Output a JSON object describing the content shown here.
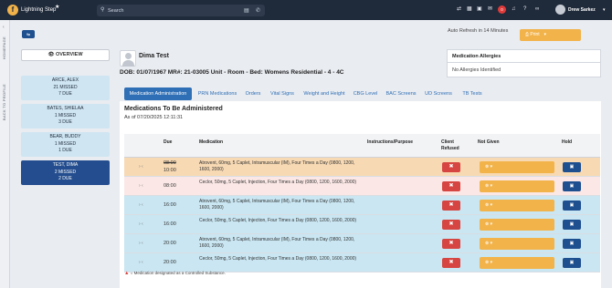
{
  "app": {
    "name": "Lightning Step",
    "logo_letter": "f",
    "search_placeholder": "Search"
  },
  "header": {
    "notification_count": "0",
    "user_name": "Drew Sarkez",
    "caret": "▾"
  },
  "rail": {
    "homepage_label": "HOMEPAGE",
    "back_label": "BACK TO PROFILE"
  },
  "sidebar": {
    "back_button": "⇆",
    "overview_label": "OVERVIEW",
    "patients": [
      {
        "name": "ARCE, ALEX",
        "missed": "21 MISSED",
        "due": "7 DUE"
      },
      {
        "name": "BATES, SHIELAA",
        "missed": "1 MISSED",
        "due": "3 DUE"
      },
      {
        "name": "BEAR, BUDDY",
        "missed": "1 MISSED",
        "due": "1 DUE"
      },
      {
        "name": "TEST, DIMA",
        "missed": "2 MISSED",
        "due": "2 DUE"
      }
    ]
  },
  "main": {
    "auto_refresh": "Auto Refresh in 14 Minutes",
    "print_label": "Print",
    "patient_name": "Dima Test",
    "patient_info": "DOB: 01/07/1967   MR#: 21-03005   Unit - Room - Bed: Womens Residential - 4 - 4C",
    "allergies": {
      "title": "Medication Allergies",
      "value": "No Allergies Identified"
    },
    "tabs": [
      {
        "label": "Medication Administration"
      },
      {
        "label": "PRN Medications"
      },
      {
        "label": "Orders"
      },
      {
        "label": "Vital Signs"
      },
      {
        "label": "Weight and Height"
      },
      {
        "label": "CBG Level"
      },
      {
        "label": "BAC Screens"
      },
      {
        "label": "UD Screens"
      },
      {
        "label": "TB Tests"
      }
    ],
    "section_title": "Medications To Be Administered",
    "as_of": "As of 07/20/2025 12:11:31",
    "columns": {
      "due": "Due",
      "medication": "Medication",
      "instructions": "Instructions/Purpose",
      "refused": "Client Refused",
      "not_given": "Not Given",
      "hold": "Hold"
    },
    "rows": [
      {
        "ctrl": "›    ‹",
        "due_old": "08:00",
        "due": "10:00",
        "med": "Atrovent, 60mg, 5 Caplet, Intramuscular (IM), Four Times a Day (0800, 1200, 1600, 2000)",
        "refuse_icon": "✖",
        "not_given": "⊗   ▾",
        "hold_icon": "▣",
        "status": "orange"
      },
      {
        "ctrl": "›    ‹",
        "due_old": "",
        "due": "08:00",
        "med": "Ceclor, 50mg, 5 Caplet, Injection, Four Times a Day (0800, 1200, 1600, 2000)",
        "refuse_icon": "✖",
        "not_given": "⊗   ▾",
        "hold_icon": "▣",
        "status": "pink"
      },
      {
        "ctrl": "›    ‹",
        "due_old": "",
        "due": "16:00",
        "med": "Atrovent, 60mg, 5 Caplet, Intramuscular (IM), Four Times a Day (0800, 1200, 1600, 2000)",
        "refuse_icon": "✖",
        "not_given": "⊗   ▾",
        "hold_icon": "▣",
        "status": "blue"
      },
      {
        "ctrl": "›    ‹",
        "due_old": "",
        "due": "16:00",
        "med": "Ceclor, 50mg, 5 Caplet, Injection, Four Times a Day (0800, 1200, 1600, 2000)",
        "refuse_icon": "✖",
        "not_given": "⊗   ▾",
        "hold_icon": "▣",
        "status": "blue"
      },
      {
        "ctrl": "›    ‹",
        "due_old": "",
        "due": "20:00",
        "med": "Atrovent, 60mg, 5 Caplet, Intramuscular (IM), Four Times a Day (0800, 1200, 1600, 2000)",
        "refuse_icon": "✖",
        "not_given": "⊗   ▾",
        "hold_icon": "▣",
        "status": "blue"
      },
      {
        "ctrl": "›    ‹",
        "due_old": "",
        "due": "20:00",
        "med": "Ceclor, 50mg, 5 Caplet, Injection, Four Times a Day (0800, 1200, 1600, 2000)",
        "refuse_icon": "✖",
        "not_given": "⊗   ▾",
        "hold_icon": "▣",
        "status": "blue"
      }
    ],
    "footnote_icon": "▲",
    "footnote": " = Medication designated as a Controlled Substance."
  },
  "colors": {
    "topbar": "#1f2a3a",
    "accent_orange": "#f2b34a",
    "accent_blue": "#2f6fb5",
    "refuse_red": "#d64541",
    "hold_navy": "#1e4f8f"
  }
}
